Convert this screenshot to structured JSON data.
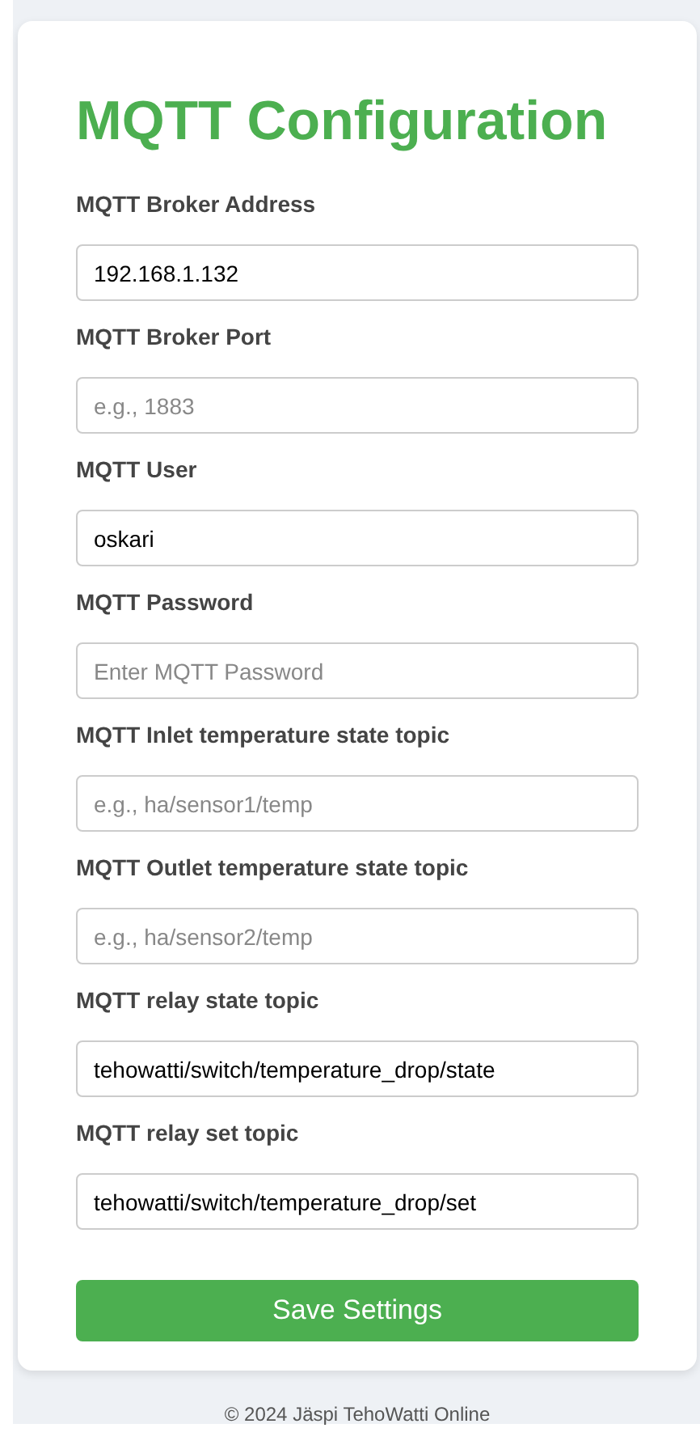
{
  "title": "MQTT Configuration",
  "fields": [
    {
      "label": "MQTT Broker Address",
      "value": "192.168.1.132"
    },
    {
      "label": "MQTT Broker Port",
      "placeholder": "e.g., 1883"
    },
    {
      "label": "MQTT User",
      "value": "oskari"
    },
    {
      "label": "MQTT Password",
      "placeholder": "Enter MQTT Password"
    },
    {
      "label": "MQTT Inlet temperature state topic",
      "placeholder": "e.g., ha/sensor1/temp"
    },
    {
      "label": "MQTT Outlet temperature state topic",
      "placeholder": "e.g., ha/sensor2/temp"
    },
    {
      "label": "MQTT relay state topic",
      "value": "tehowatti/switch/temperature_drop/state"
    },
    {
      "label": "MQTT relay set topic",
      "value": "tehowatti/switch/temperature_drop/set"
    }
  ],
  "button": "Save Settings",
  "footer": "© 2024 Jäspi TehoWatti Online"
}
